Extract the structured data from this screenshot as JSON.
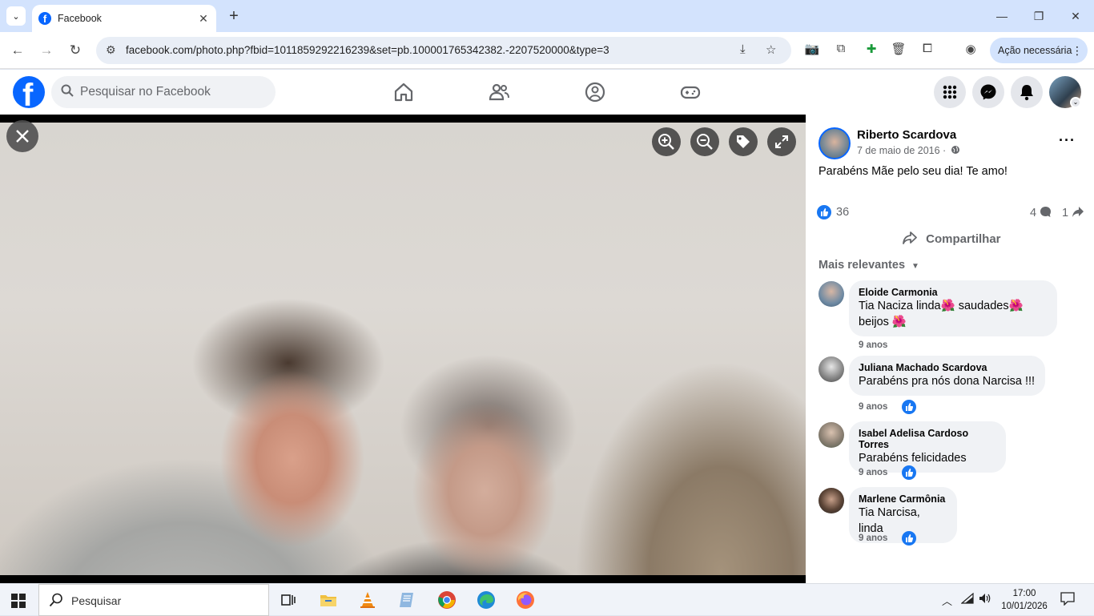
{
  "browser": {
    "tab_title": "Facebook",
    "url": "facebook.com/photo.php?fbid=1011859292216239&set=pb.100001765342382.-2207520000&type=3",
    "action_label": "Ação necessária"
  },
  "fb": {
    "search_placeholder": "Pesquisar no Facebook"
  },
  "post": {
    "author": "Riberto Scardova",
    "date": "7 de maio de 2016 ·",
    "text": "Parabéns Mãe pelo seu dia! Te amo!",
    "likes": "36",
    "comments_count": "4",
    "shares_count": "1",
    "share_label": "Compartilhar",
    "sort_label": "Mais relevantes"
  },
  "comments": [
    {
      "name": "Eloide Carmonia",
      "text1": "Tia Naciza linda🌺 saudades🌺",
      "text2": "beijos 🌺",
      "time": "9 anos"
    },
    {
      "name": "Juliana Machado Scardova",
      "text1": "Parabéns pra nós dona Narcisa !!!",
      "time": "9 anos"
    },
    {
      "name": "Isabel Adelisa Cardoso Torres",
      "text1": "Parabéns felicidades",
      "time": "9 anos"
    },
    {
      "name": "Marlene Carmônia",
      "text1": "Tia Narcisa, linda",
      "time": "9 anos"
    }
  ],
  "taskbar": {
    "search_placeholder": "Pesquisar",
    "time": "17:00",
    "date": "10/01/2026"
  },
  "colors": {
    "fb_blue": "#0866ff",
    "like_blue": "#1877f2",
    "chrome_tab_bg": "#d3e3fd"
  }
}
